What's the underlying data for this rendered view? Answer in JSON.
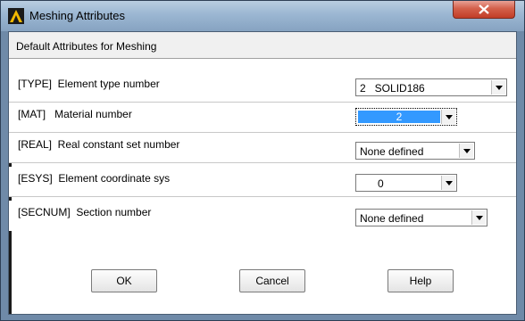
{
  "window": {
    "title": "Meshing Attributes"
  },
  "header": {
    "text": "Default Attributes for Meshing"
  },
  "attributes": [
    {
      "label": "[TYPE]  Element type number",
      "value": "2   SOLID186"
    },
    {
      "label": "[MAT]   Material number",
      "value": "2"
    },
    {
      "label": "[REAL]  Real constant set number",
      "value": "None defined"
    },
    {
      "label": "[ESYS]  Element coordinate sys",
      "value": "0"
    },
    {
      "label": "[SECNUM]  Section number",
      "value": "None defined"
    }
  ],
  "buttons": {
    "ok": "OK",
    "cancel": "Cancel",
    "help": "Help"
  },
  "colors": {
    "selection": "#3399ff",
    "close_button": "#c13d27",
    "titlebar": "#9bb6d2"
  },
  "icons": [
    "ansys-logo-icon",
    "close-icon",
    "dropdown-arrow-icon"
  ]
}
